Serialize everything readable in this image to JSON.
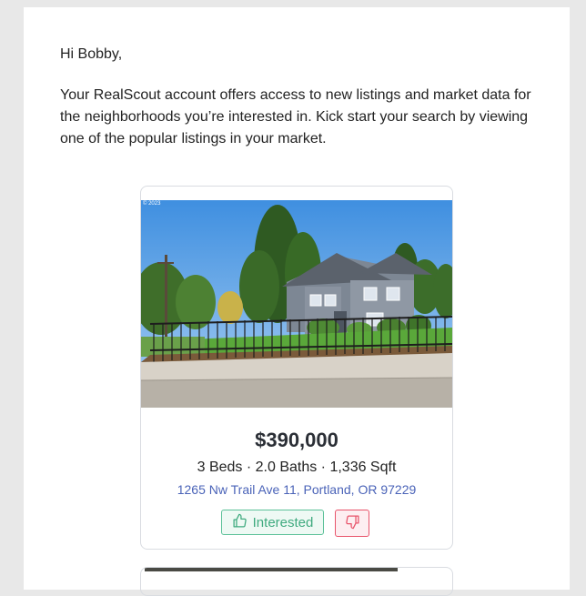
{
  "email": {
    "greeting": "Hi Bobby,",
    "intro": "Your RealScout account offers access to new listings and market data for the neighborhoods you’re interested in. Kick start your search by viewing one of the popular listings in your market."
  },
  "listing": {
    "photo_copyright": "© 2023",
    "price": "$390,000",
    "specs": "3 Beds · 2.0 Baths · 1,336 Sqft",
    "address": "1265 Nw Trail Ave 11, Portland, OR 97229",
    "interested_label": "Interested",
    "interested_icon": "thumbs-up-icon",
    "dislike_icon": "thumbs-down-icon"
  },
  "colors": {
    "interested_green": "#3faa7f",
    "dislike_red": "#e8546b",
    "address_link": "#4a63b8"
  }
}
